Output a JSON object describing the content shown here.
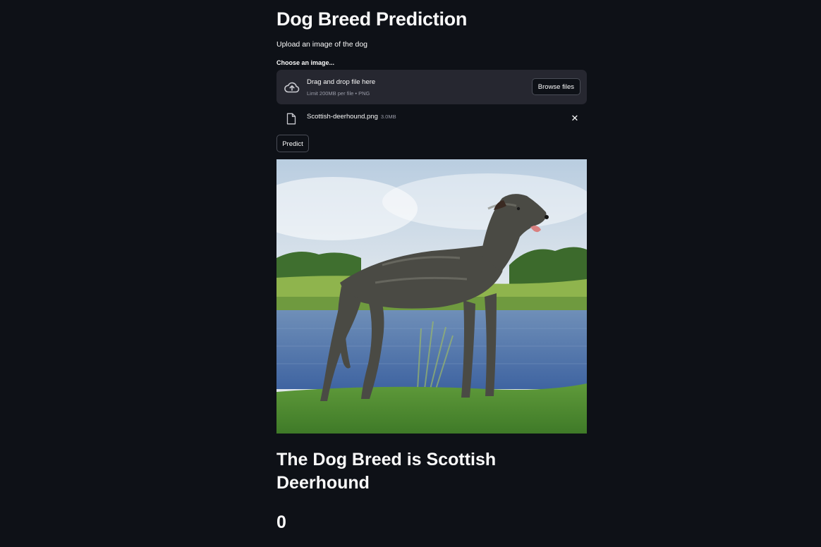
{
  "app": {
    "title": "Dog Breed Prediction",
    "subtitle": "Upload an image of the dog"
  },
  "uploader": {
    "label": "Choose an image...",
    "drop_text": "Drag and drop file here",
    "limit_text": "Limit 200MB per file • PNG",
    "browse_label": "Browse files",
    "icon": "cloud-upload-icon"
  },
  "uploaded_file": {
    "name": "Scottish-deerhound.png",
    "size": "3.0MB",
    "icon": "file-icon",
    "remove_icon": "close-icon",
    "remove_glyph": "✕"
  },
  "predict_label": "Predict",
  "result": {
    "text": "The Dog Breed is Scottish Deerhound",
    "value": "0"
  },
  "colors": {
    "background": "#0e1117",
    "panel": "#262730",
    "text": "#fafafa",
    "muted": "#9a9ca8"
  }
}
